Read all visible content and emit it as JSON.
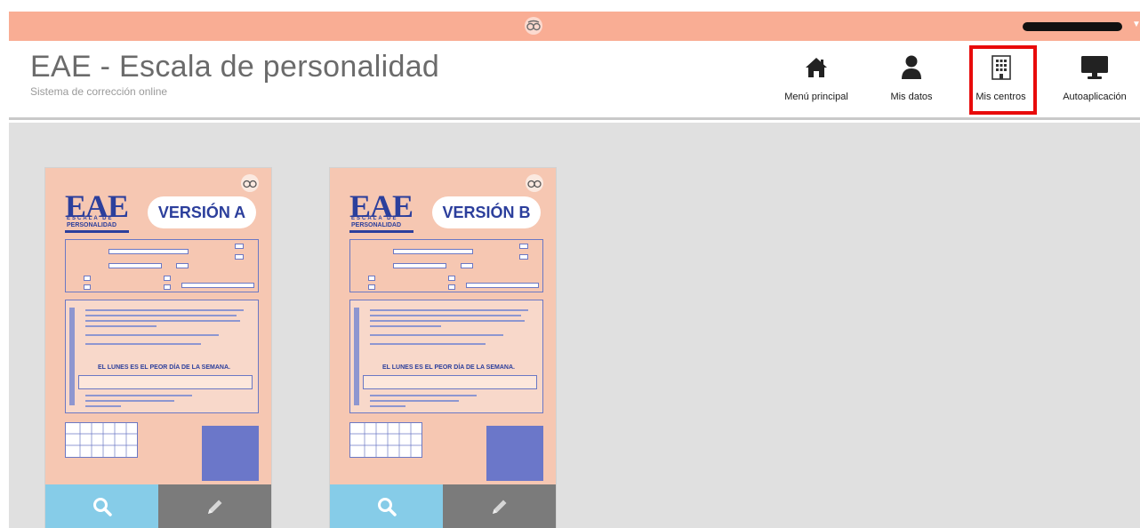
{
  "header": {
    "title": "EAE - Escala de personalidad",
    "subtitle": "Sistema de corrección online"
  },
  "nav": [
    {
      "label": "Menú principal",
      "icon": "home-icon"
    },
    {
      "label": "Mis datos",
      "icon": "user-icon"
    },
    {
      "label": "Mis centros",
      "icon": "building-icon",
      "highlighted": true
    },
    {
      "label": "Autoaplicación",
      "icon": "monitor-icon"
    }
  ],
  "tests": [
    {
      "version_label": "VERSIÓN A",
      "logo": "EAE",
      "logo_sub": "ESCALA DE",
      "logo_sub2": "PERSONALIDAD",
      "instruction_example": "EL LUNES ES EL PEOR DÍA DE LA SEMANA."
    },
    {
      "version_label": "VERSIÓN B",
      "logo": "EAE",
      "logo_sub": "ESCALA DE",
      "logo_sub2": "PERSONALIDAD",
      "instruction_example": "EL LUNES ES EL PEOR DÍA DE LA SEMANA."
    }
  ],
  "colors": {
    "topbar": "#f9ad94",
    "highlight": "#e80b0b",
    "view_button": "#86cce8",
    "edit_button": "#7b7b7b",
    "cover": "#f6c7b2",
    "brand_blue": "#2c3f9c"
  }
}
